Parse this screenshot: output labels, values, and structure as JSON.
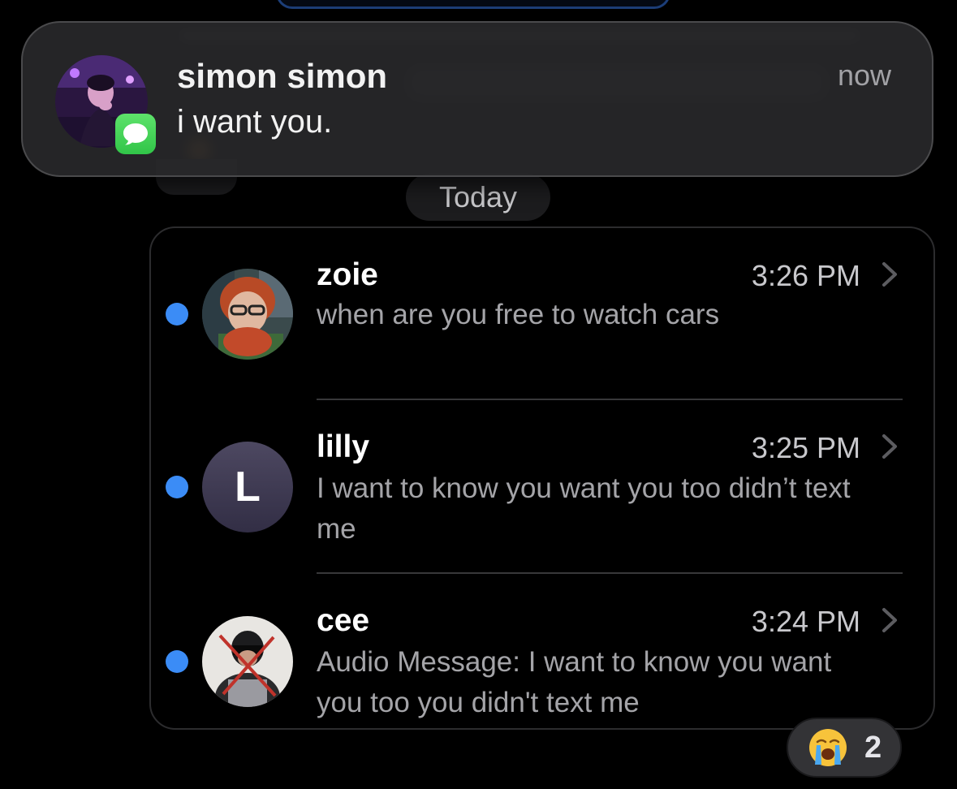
{
  "notification": {
    "sender": "simon simon",
    "message": "i want you.",
    "time": "now",
    "app_icon": "messages-icon"
  },
  "divider_label": "Today",
  "conversations": [
    {
      "name": "zoie",
      "time": "3:26 PM",
      "preview": "when are you free to watch cars",
      "unread": true,
      "avatar": "photo"
    },
    {
      "name": "lilly",
      "time": "3:25 PM",
      "preview": "I want to know you want you too didn’t text me",
      "unread": true,
      "avatar_initial": "L"
    },
    {
      "name": "cee",
      "time": "3:24 PM",
      "preview": "Audio Message: I want to know you want you too you didn't text me",
      "unread": true,
      "avatar": "photo"
    }
  ],
  "reaction": {
    "emoji": "loudly-crying-face-icon",
    "count": "2"
  },
  "colors": {
    "unread_dot": "#3b8cf6",
    "messages_green": "#34c759",
    "background": "#000000"
  }
}
